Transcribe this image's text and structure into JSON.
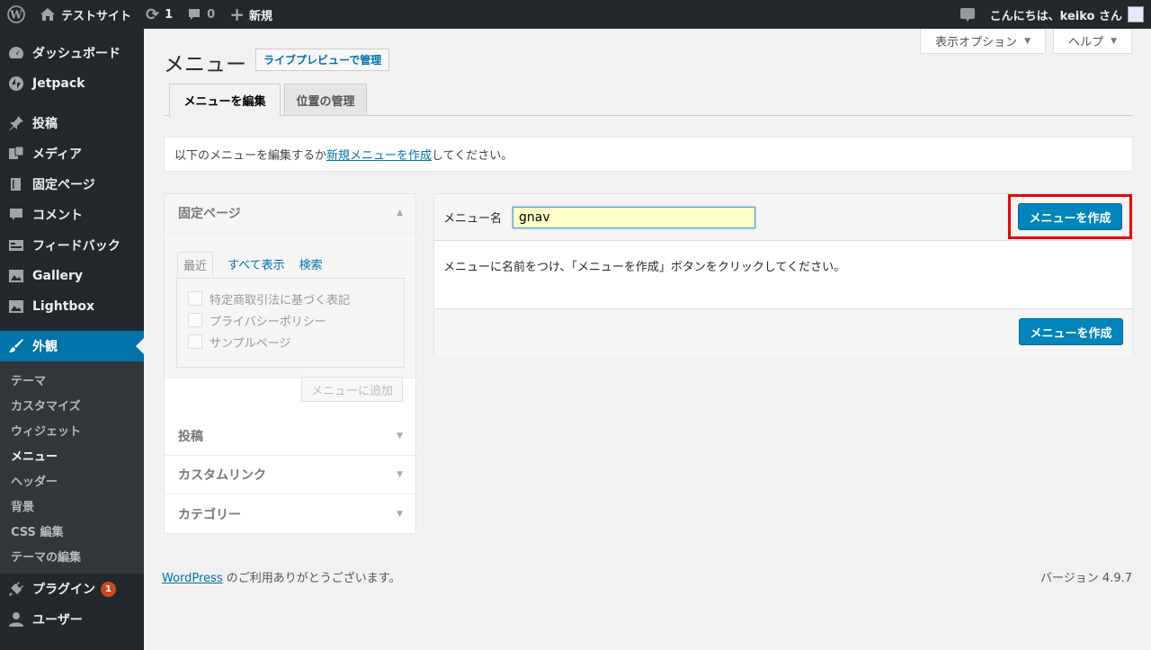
{
  "adminbar": {
    "site_name": "テストサイト",
    "updates_count": "1",
    "comments_count": "0",
    "new_label": "新規",
    "greeting": "こんにちは、keiko さん"
  },
  "sidebar": {
    "items": [
      {
        "label": "ダッシュボード",
        "icon": "dashboard-icon"
      },
      {
        "label": "Jetpack",
        "icon": "jetpack-icon"
      },
      {
        "label": "投稿",
        "icon": "pin-icon"
      },
      {
        "label": "メディア",
        "icon": "media-icon"
      },
      {
        "label": "固定ページ",
        "icon": "page-icon"
      },
      {
        "label": "コメント",
        "icon": "comment-icon"
      },
      {
        "label": "フィードバック",
        "icon": "feedback-icon"
      },
      {
        "label": "Gallery",
        "icon": "gallery-icon"
      },
      {
        "label": "Lightbox",
        "icon": "lightbox-icon"
      },
      {
        "label": "外観",
        "icon": "brush-icon"
      },
      {
        "label": "プラグイン",
        "icon": "plugin-icon",
        "badge": "1"
      },
      {
        "label": "ユーザー",
        "icon": "user-icon"
      }
    ],
    "appearance_sub": [
      "テーマ",
      "カスタマイズ",
      "ウィジェット",
      "メニュー",
      "ヘッダー",
      "背景",
      "CSS 編集",
      "テーマの編集"
    ]
  },
  "screen_options": {
    "display_options": "表示オプション",
    "help": "ヘルプ"
  },
  "page": {
    "title": "メニュー",
    "live_preview_button": "ライブプレビューで管理",
    "tabs": [
      "メニューを編集",
      "位置の管理"
    ],
    "notice_prefix": "以下のメニューを編集するか",
    "notice_link": "新規メニューを作成",
    "notice_suffix": "してください。"
  },
  "accordion": {
    "pages_title": "固定ページ",
    "sub_tabs": [
      "最近",
      "すべて表示",
      "検索"
    ],
    "pages": [
      "特定商取引法に基づく表記",
      "プライバシーポリシー",
      "サンプルページ"
    ],
    "add_button": "メニューに追加",
    "sections": [
      "投稿",
      "カスタムリンク",
      "カテゴリー"
    ]
  },
  "menu_editor": {
    "name_label": "メニュー名",
    "name_value": "gnav",
    "create_button": "メニューを作成",
    "instruction": "メニューに名前をつけ、「メニューを作成」ボタンをクリックしてください。"
  },
  "footer": {
    "link": "WordPress",
    "thanks": " のご利用ありがとうございます。",
    "version": "バージョン 4.9.7"
  },
  "colors": {
    "accent": "#0073aa",
    "button": "#0085ba",
    "highlight": "#ee0000"
  }
}
